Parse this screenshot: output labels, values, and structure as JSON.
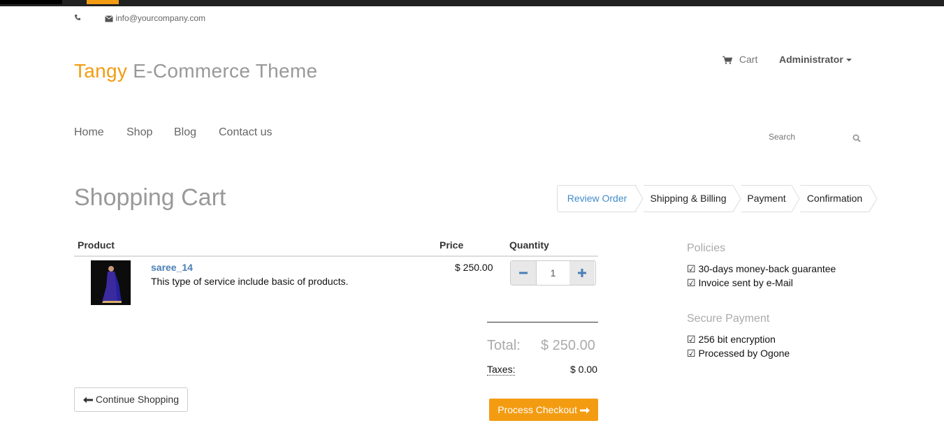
{
  "header": {
    "email": "info@yourcompany.com",
    "logo_brand": "Tangy",
    "logo_rest": " E-Commerce Theme",
    "cart_label": "Cart",
    "user_label": "Administrator"
  },
  "nav": {
    "items": [
      "Home",
      "Shop",
      "Blog",
      "Contact us"
    ]
  },
  "search": {
    "placeholder": "Search"
  },
  "page": {
    "title": "Shopping Cart"
  },
  "steps": [
    "Review Order",
    "Shipping & Billing",
    "Payment",
    "Confirmation"
  ],
  "table": {
    "headers": {
      "product": "Product",
      "price": "Price",
      "quantity": "Quantity"
    },
    "rows": [
      {
        "name": "saree_14",
        "description": "This type of service include basic of products.",
        "price": "$ 250.00",
        "quantity": "1"
      }
    ]
  },
  "summary": {
    "total_label": "Total:",
    "total_value": "$ 250.00",
    "tax_label": "Taxes:",
    "tax_value": "$ 0.00"
  },
  "buttons": {
    "continue": "Continue Shopping",
    "checkout": "Process Checkout"
  },
  "sidebar": {
    "policies_title": "Policies",
    "policies": [
      "☑ 30-days money-back guarantee",
      "☑ Invoice sent by e-Mail"
    ],
    "secure_title": "Secure Payment",
    "secure": [
      "☑ 256 bit encryption",
      "☑ Processed by Ogone"
    ]
  },
  "colors": {
    "accent": "#f39c12",
    "link": "#428bca"
  }
}
